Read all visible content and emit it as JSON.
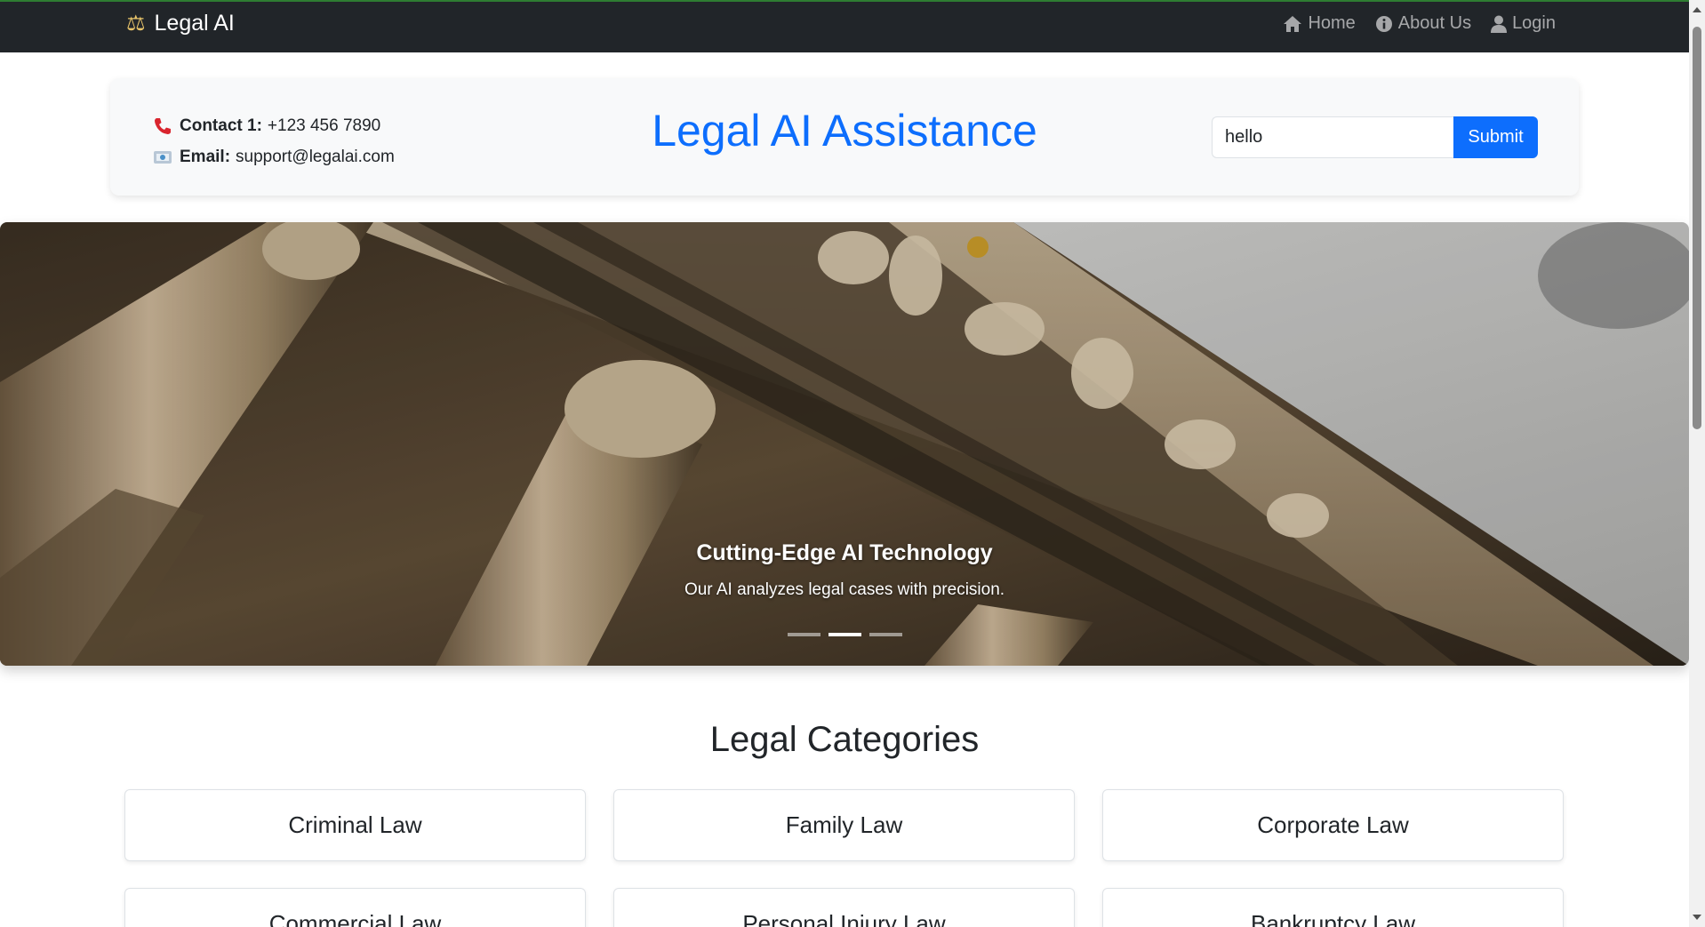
{
  "navbar": {
    "brand": "Legal AI",
    "links": [
      {
        "label": "Home",
        "icon": "home-icon"
      },
      {
        "label": "About Us",
        "icon": "info-icon"
      },
      {
        "label": "Login",
        "icon": "user-icon"
      }
    ]
  },
  "header": {
    "contact_label": "Contact 1:",
    "contact_value": "+123 456 7890",
    "email_label": "Email:",
    "email_value": "support@legalai.com",
    "title": "Legal AI Assistance",
    "search_value": "hello",
    "submit_label": "Submit"
  },
  "carousel": {
    "caption_title": "Cutting-Edge AI Technology",
    "caption_text": "Our AI analyzes legal cases with precision.",
    "slide_count": 3,
    "active_index": 1
  },
  "categories": {
    "title": "Legal Categories",
    "items": [
      "Criminal Law",
      "Family Law",
      "Corporate Law",
      "Commercial Law",
      "Personal Injury Law",
      "Bankruptcy Law"
    ]
  },
  "colors": {
    "primary": "#0d6efd",
    "navbar_bg": "#212529",
    "header_bg": "#f8f9fa"
  }
}
